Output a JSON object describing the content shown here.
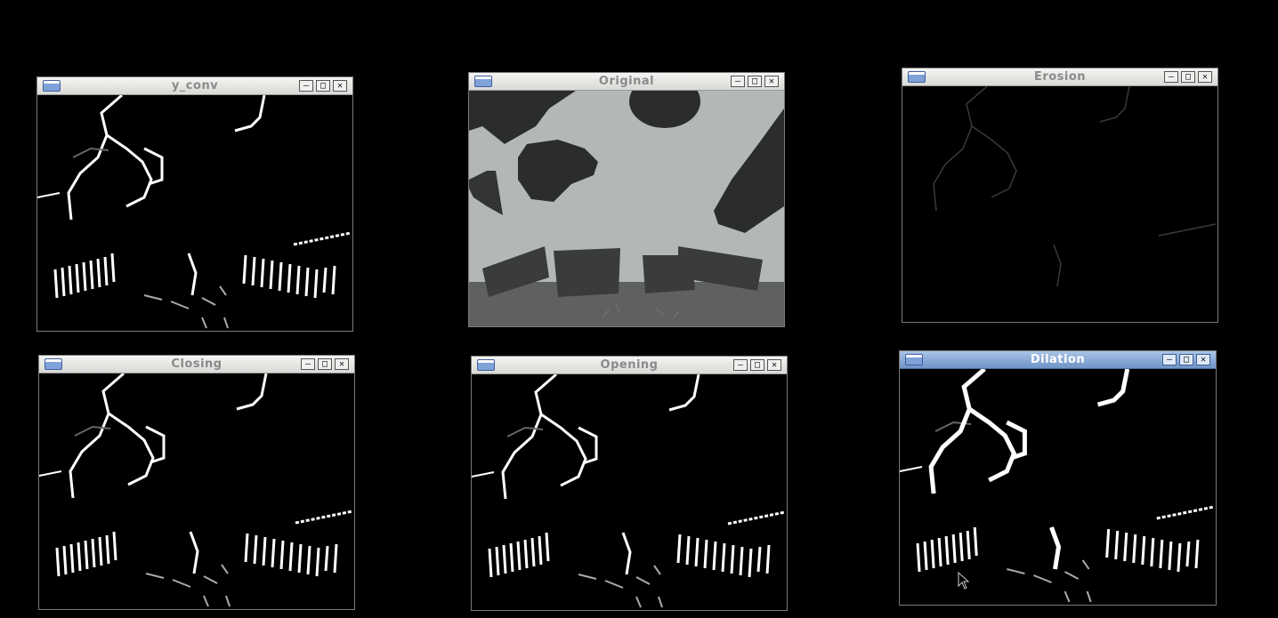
{
  "windows": {
    "y_conv": {
      "title": "y_conv"
    },
    "original": {
      "title": "Original"
    },
    "erosion": {
      "title": "Erosion"
    },
    "closing": {
      "title": "Closing"
    },
    "opening": {
      "title": "Opening"
    },
    "dilation": {
      "title": "Dilation",
      "active": true
    }
  },
  "controls": {
    "minimize": "–",
    "maximize": "□",
    "close": "✕"
  },
  "icons": {
    "app": "window-app-icon",
    "minimize": "minimize-icon",
    "maximize": "maximize-icon",
    "close": "close-icon",
    "cursor": "mouse-pointer-icon"
  },
  "colors": {
    "background": "#000000",
    "titlebar": "#e6e6e4",
    "active_titlebar": "#7d9fd0",
    "sky": "#b3b8b6",
    "ground": "#5f6160",
    "shape_dark": "#2b2d2c"
  }
}
